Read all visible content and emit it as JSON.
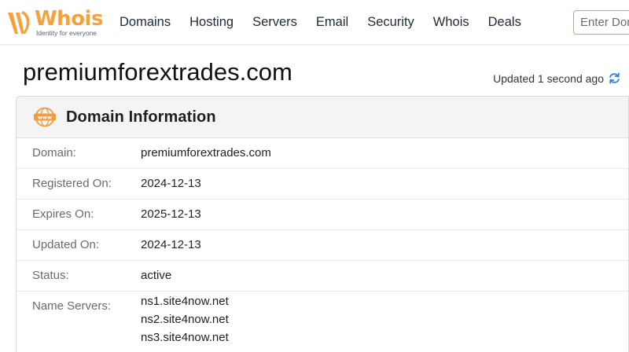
{
  "brand": {
    "name": "Whois",
    "tagline": "Identity for everyone",
    "accent": "#f6a13c"
  },
  "nav": {
    "items": [
      {
        "label": "Domains"
      },
      {
        "label": "Hosting"
      },
      {
        "label": "Servers"
      },
      {
        "label": "Email"
      },
      {
        "label": "Security"
      },
      {
        "label": "Whois"
      },
      {
        "label": "Deals"
      }
    ]
  },
  "search": {
    "placeholder": "Enter Domain"
  },
  "page": {
    "title": "premiumforextrades.com",
    "updated": "Updated 1 second ago"
  },
  "card": {
    "icon": "www-icon",
    "title": "Domain Information",
    "rows": [
      {
        "label": "Domain:",
        "value": "premiumforextrades.com"
      },
      {
        "label": "Registered On:",
        "value": "2024-12-13"
      },
      {
        "label": "Expires On:",
        "value": "2025-12-13"
      },
      {
        "label": "Updated On:",
        "value": "2024-12-13"
      },
      {
        "label": "Status:",
        "value": "active"
      }
    ],
    "name_servers": {
      "label": "Name Servers:",
      "values": [
        "ns1.site4now.net",
        "ns2.site4now.net",
        "ns3.site4now.net"
      ]
    }
  }
}
